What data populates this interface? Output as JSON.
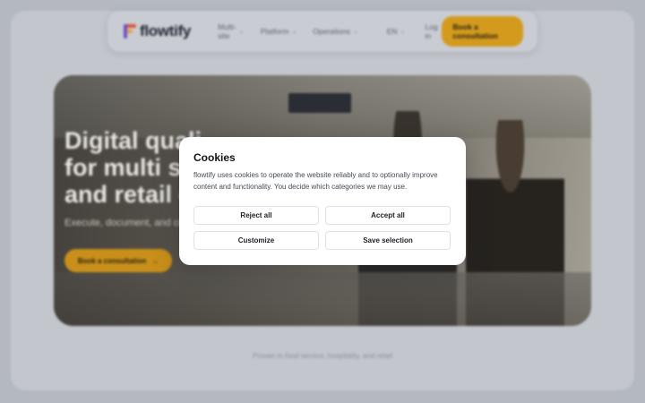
{
  "nav": {
    "logo_text": "flowtify",
    "links": [
      {
        "label": "Multi-site"
      },
      {
        "label": "Platform"
      },
      {
        "label": "Operations"
      }
    ],
    "language": "EN",
    "login": "Log in",
    "cta": "Book a consultation",
    "chevron": "⌄"
  },
  "hero": {
    "title_line1": "Digital quali",
    "title_line2": "for multi site",
    "title_line3": "and retail op",
    "subtitle": "Execute, document, and co",
    "cta": "Book a consultation",
    "cta_arrow": "→"
  },
  "proof_text": "Proven in food service, hospitality, and retail",
  "modal": {
    "title": "Cookies",
    "text": "flowtify uses cookies to operate the website reliably and to optionally improve content and functionality. You decide which categories we may use.",
    "reject_all": "Reject all",
    "accept_all": "Accept all",
    "customize": "Customize",
    "save_selection": "Save selection"
  },
  "colors": {
    "accent": "#d49a1e",
    "modal_bg": "#ffffff",
    "overlay": "#b3b8c1"
  }
}
